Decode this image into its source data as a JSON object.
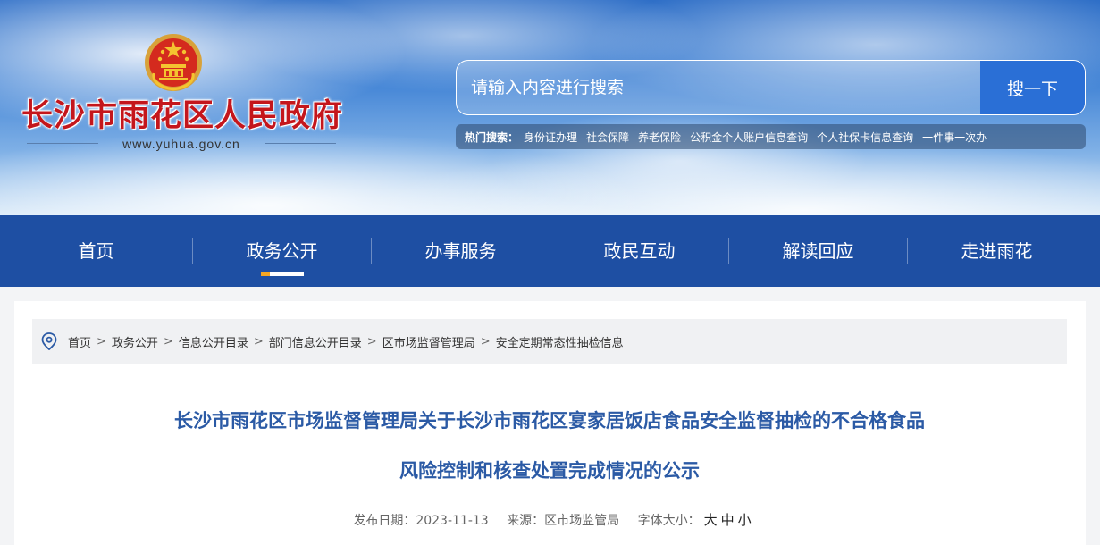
{
  "header": {
    "site_name": "长沙市雨花区人民政府",
    "site_url": "www.yuhua.gov.cn",
    "emblem_icon": "national-emblem-icon"
  },
  "search": {
    "placeholder": "请输入内容进行搜索",
    "button_label": "搜一下",
    "hot_label": "热门搜索：",
    "hot_items": [
      "身份证办理",
      "社会保障",
      "养老保险",
      "公积金个人账户信息查询",
      "个人社保卡信息查询",
      "一件事一次办"
    ]
  },
  "nav": {
    "items": [
      {
        "label": "首页"
      },
      {
        "label": "政务公开"
      },
      {
        "label": "办事服务"
      },
      {
        "label": "政民互动"
      },
      {
        "label": "解读回应"
      },
      {
        "label": "走进雨花"
      }
    ],
    "active_index": 1
  },
  "breadcrumb": {
    "icon": "location-pin-icon",
    "separator": ">",
    "items": [
      "首页",
      "政务公开",
      "信息公开目录",
      "部门信息公开目录",
      "区市场监督管理局",
      "安全定期常态性抽检信息"
    ]
  },
  "article": {
    "title_line1": "长沙市雨花区市场监督管理局关于长沙市雨花区宴家居饭店食品安全监督抽检的不合格食品",
    "title_line2": "风险控制和核查处置完成情况的公示",
    "publish_date": "发布日期：2023-11-13",
    "source": "来源：区市场监管局",
    "font_size_label": "字体大小：",
    "font_sizes": [
      "大",
      "中",
      "小"
    ]
  },
  "colors": {
    "nav_bg": "#1e4fa3",
    "search_button_bg": "#2a6fd6",
    "title_color": "#2b5aa5",
    "site_name_color": "#c4161c",
    "nav_active_accent": "#f5a623"
  }
}
